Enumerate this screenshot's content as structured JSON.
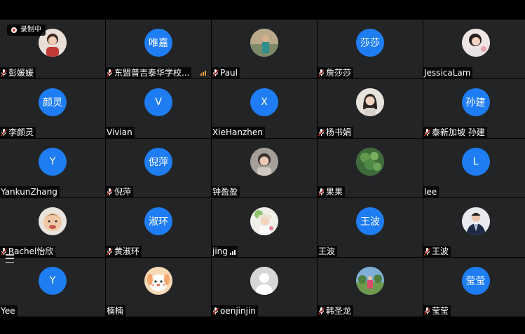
{
  "recording": {
    "label": "录制中"
  },
  "participants": [
    {
      "name": "彭媛媛",
      "avatar": "photo",
      "muted": true
    },
    {
      "name": "东盟普吉泰华学校...",
      "avatar": "唯嘉",
      "muted": true,
      "signal": true
    },
    {
      "name": "Paul",
      "avatar": "photo",
      "muted": true
    },
    {
      "name": "詹莎莎",
      "avatar": "莎莎",
      "muted": true
    },
    {
      "name": "JessicaLam",
      "avatar": "photo",
      "muted": false
    },
    {
      "name": "李颜灵",
      "avatar": "颜灵",
      "muted": true
    },
    {
      "name": "Vivian",
      "avatar": "V",
      "muted": false
    },
    {
      "name": "XieHanzhen",
      "avatar": "X",
      "muted": false
    },
    {
      "name": "杨书娟",
      "avatar": "photo",
      "muted": true
    },
    {
      "name": "泰新加坡 孙建",
      "avatar": "孙建",
      "muted": true
    },
    {
      "name": "YankunZhang",
      "avatar": "Y",
      "muted": false
    },
    {
      "name": "倪萍",
      "avatar": "倪萍",
      "muted": true
    },
    {
      "name": "钟盈盈",
      "avatar": "photo",
      "muted": false
    },
    {
      "name": "果果",
      "avatar": "photo",
      "muted": true
    },
    {
      "name": "lee",
      "avatar": "L",
      "muted": false
    },
    {
      "name": "Rachel怡欣",
      "avatar": "photo",
      "muted": true
    },
    {
      "name": "黄淑环",
      "avatar": "淑环",
      "muted": true
    },
    {
      "name": "jing",
      "avatar": "photo",
      "muted": false,
      "signal": true
    },
    {
      "name": "王波",
      "avatar": "王波",
      "muted": false
    },
    {
      "name": "王波",
      "avatar": "photo",
      "muted": true
    },
    {
      "name": "Yee",
      "avatar": "Y",
      "muted": false
    },
    {
      "name": "楠楠",
      "avatar": "photo",
      "muted": false
    },
    {
      "name": "oenjinjin",
      "avatar": "photo",
      "muted": true
    },
    {
      "name": "韩圣龙",
      "avatar": "photo",
      "muted": true
    },
    {
      "name": "莹莹",
      "avatar": "莹莹",
      "muted": true
    }
  ]
}
